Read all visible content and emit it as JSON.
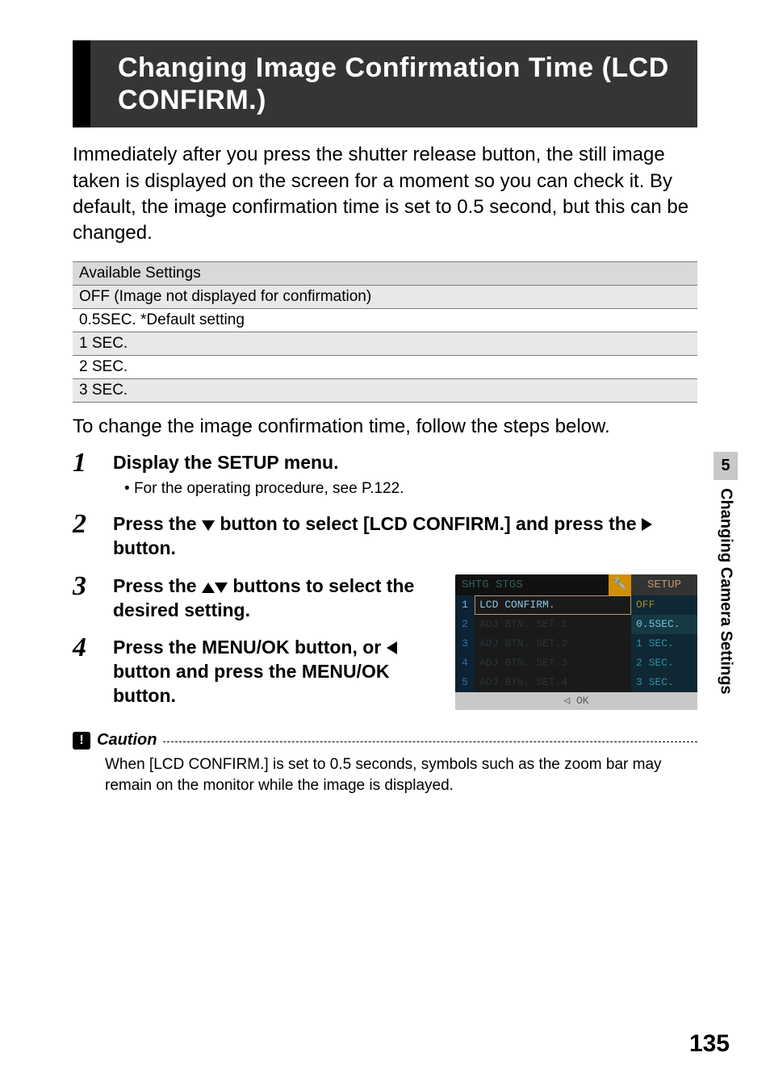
{
  "title": "Changing Image Confirmation Time (LCD CONFIRM.)",
  "intro": "Immediately after you press the shutter release button, the still image taken is displayed on the screen for a moment so you can check it. By default, the image confirmation time is set to 0.5 second, but this can be changed.",
  "settings_header": "Available Settings",
  "settings": [
    "OFF (Image not displayed for confirmation)",
    "0.5SEC. *Default setting",
    "1 SEC.",
    "2 SEC.",
    "3 SEC."
  ],
  "follow": "To change the image confirmation time, follow the steps below.",
  "steps": [
    {
      "head": "Display the SETUP menu.",
      "sub": "For the operating procedure, see P.122."
    },
    {
      "head_pre": "Press the ",
      "head_mid": " button to select [LCD CONFIRM.] and press the ",
      "head_post": " button."
    },
    {
      "head_pre": "Press the ",
      "head_post": " buttons to select the desired setting."
    },
    {
      "head_pre": "Press the MENU/OK button, or ",
      "head_post": " button and press the MENU/OK button."
    }
  ],
  "camera": {
    "header_left": "SHTG STGS",
    "header_right": "SETUP",
    "rows": [
      "1",
      "2",
      "3",
      "4",
      "5"
    ],
    "mid": [
      "LCD CONFIRM.",
      "ADJ BTN. SET.1",
      "ADJ BTN. SET.2",
      "ADJ BTN. SET.3",
      "ADJ BTN. SET.4"
    ],
    "right": [
      "OFF",
      "0.5SEC.",
      "1 SEC.",
      "2 SEC.",
      "3 SEC."
    ],
    "footer": "◁ OK"
  },
  "caution_label": "Caution",
  "caution_body": "When [LCD CONFIRM.] is set to 0.5 seconds, symbols such as the zoom bar may remain on the monitor while the image is displayed.",
  "side": {
    "num": "5",
    "label": "Changing Camera Settings"
  },
  "page_num": "135"
}
